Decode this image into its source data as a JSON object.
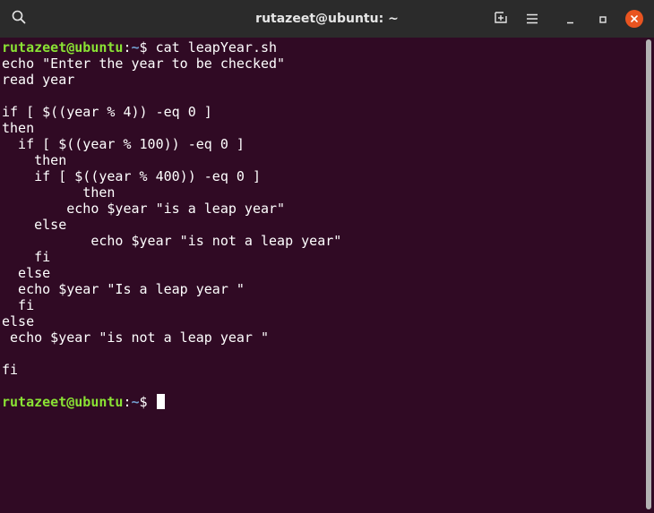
{
  "window": {
    "title": "rutazeet@ubuntu: ~"
  },
  "titlebar_icons": {
    "search": "search-icon",
    "new_tab": "new-tab-icon",
    "menu": "hamburger-menu-icon",
    "minimize": "minimize-icon",
    "maximize": "maximize-icon",
    "close": "close-icon",
    "close_color": "#e95420"
  },
  "terminal": {
    "prompt": {
      "user_host": "rutazeet@ubuntu",
      "sep": ":",
      "path": "~",
      "symbol": "$ "
    },
    "command": "cat leapYear.sh",
    "output_lines": [
      "echo \"Enter the year to be checked\"",
      "read year",
      "",
      "if [ $((year % 4)) -eq 0 ]",
      "then",
      "  if [ $((year % 100)) -eq 0 ]",
      "    then",
      "    if [ $((year % 400)) -eq 0 ]",
      "          then",
      "        echo $year \"is a leap year\"",
      "    else",
      "           echo $year \"is not a leap year\"",
      "    fi",
      "  else",
      "  echo $year \"Is a leap year \"",
      "  fi",
      "else",
      " echo $year \"is not a leap year \"",
      "",
      "fi",
      ""
    ],
    "colors": {
      "background": "#300a24",
      "prompt_user": "#8ae234",
      "prompt_path": "#729fcf",
      "text": "#ffffff"
    }
  }
}
